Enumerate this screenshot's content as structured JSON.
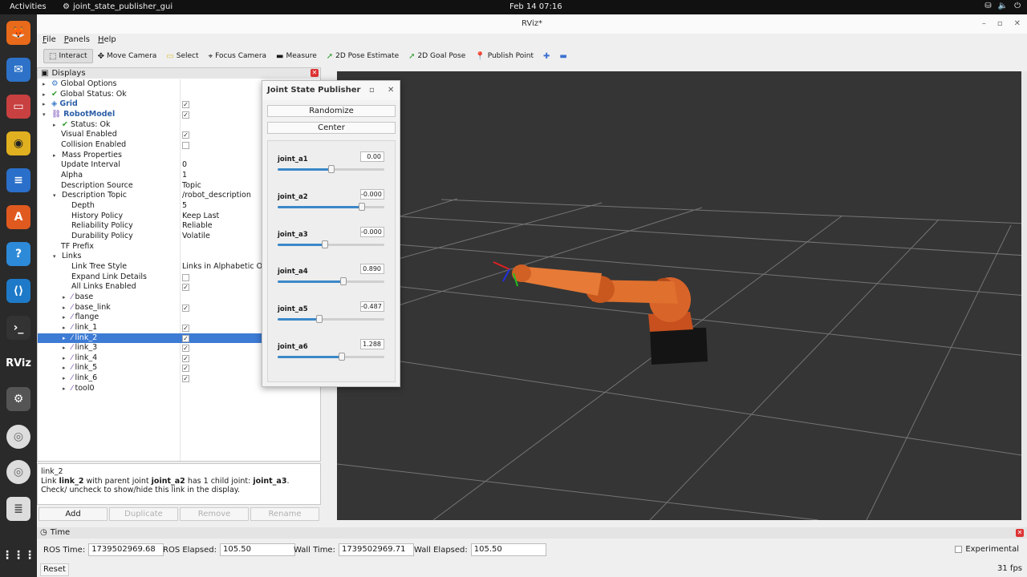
{
  "topbar": {
    "activities": "Activities",
    "app": "joint_state_publisher_gui",
    "clock": "Feb 14  07:16"
  },
  "window": {
    "title": "RViz*"
  },
  "menu": [
    "File",
    "Panels",
    "Help"
  ],
  "toolbar": [
    {
      "label": "Interact",
      "icon": "interact-icon",
      "active": true
    },
    {
      "label": "Move Camera",
      "icon": "move-camera-icon"
    },
    {
      "label": "Select",
      "icon": "select-icon"
    },
    {
      "label": "Focus Camera",
      "icon": "focus-camera-icon"
    },
    {
      "label": "Measure",
      "icon": "measure-icon"
    },
    {
      "label": "2D Pose Estimate",
      "icon": "pose-estimate-icon"
    },
    {
      "label": "2D Goal Pose",
      "icon": "goal-pose-icon"
    },
    {
      "label": "Publish Point",
      "icon": "publish-point-icon"
    }
  ],
  "displays": {
    "title": "Displays",
    "rows": [
      {
        "name": "Global Options",
        "value": "",
        "check": null
      },
      {
        "name": "Global Status: Ok",
        "value": "",
        "check": null
      },
      {
        "name": "Grid",
        "value": "",
        "check": true
      },
      {
        "name": "RobotModel",
        "value": "",
        "check": true
      },
      {
        "name": "Status: Ok",
        "value": "",
        "check": null
      },
      {
        "name": "Visual Enabled",
        "value": "",
        "check": true
      },
      {
        "name": "Collision Enabled",
        "value": "",
        "check": false
      },
      {
        "name": "Mass Properties",
        "value": "",
        "check": null
      },
      {
        "name": "Update Interval",
        "value": "0",
        "check": null
      },
      {
        "name": "Alpha",
        "value": "1",
        "check": null
      },
      {
        "name": "Description Source",
        "value": "Topic",
        "check": null
      },
      {
        "name": "Description Topic",
        "value": "/robot_description",
        "check": null
      },
      {
        "name": "Depth",
        "value": "5",
        "check": null
      },
      {
        "name": "History Policy",
        "value": "Keep Last",
        "check": null
      },
      {
        "name": "Reliability Policy",
        "value": "Reliable",
        "check": null
      },
      {
        "name": "Durability Policy",
        "value": "Volatile",
        "check": null
      },
      {
        "name": "TF Prefix",
        "value": "",
        "check": null
      },
      {
        "name": "Links",
        "value": "",
        "check": null
      },
      {
        "name": "Link Tree Style",
        "value": "Links in Alphabetic Or",
        "check": null
      },
      {
        "name": "Expand Link Details",
        "value": "",
        "check": false
      },
      {
        "name": "All Links Enabled",
        "value": "",
        "check": true
      },
      {
        "name": "base",
        "value": "",
        "check": null
      },
      {
        "name": "base_link",
        "value": "",
        "check": true
      },
      {
        "name": "flange",
        "value": "",
        "check": null
      },
      {
        "name": "link_1",
        "value": "",
        "check": true
      },
      {
        "name": "link_2",
        "value": "",
        "check": true
      },
      {
        "name": "link_3",
        "value": "",
        "check": true
      },
      {
        "name": "link_4",
        "value": "",
        "check": true
      },
      {
        "name": "link_5",
        "value": "",
        "check": true
      },
      {
        "name": "link_6",
        "value": "",
        "check": true
      },
      {
        "name": "tool0",
        "value": "",
        "check": null
      }
    ]
  },
  "help": {
    "title": "link_2",
    "p1": "Link ",
    "b1": "link_2",
    "p2": " with parent joint ",
    "b2": "joint_a2",
    "p3": " has 1 child joint: ",
    "b3": "joint_a3",
    "p4": ". Check/ uncheck to show/hide this link in the display."
  },
  "panel_buttons": [
    "Add",
    "Duplicate",
    "Remove",
    "Rename"
  ],
  "jsp": {
    "title": "Joint State Publisher",
    "randomize": "Randomize",
    "center": "Center",
    "joints": [
      {
        "name": "joint_a1",
        "value": "0.00",
        "fraction": 0.5
      },
      {
        "name": "joint_a2",
        "value": "-0.000",
        "fraction": 0.79
      },
      {
        "name": "joint_a3",
        "value": "-0.000",
        "fraction": 0.44
      },
      {
        "name": "joint_a4",
        "value": "0.890",
        "fraction": 0.62
      },
      {
        "name": "joint_a5",
        "value": "-0.487",
        "fraction": 0.39
      },
      {
        "name": "joint_a6",
        "value": "1.288",
        "fraction": 0.6
      }
    ]
  },
  "time": {
    "title": "Time",
    "ros_time_label": "ROS Time:",
    "ros_time": "1739502969.68",
    "ros_elapsed_label": "ROS Elapsed:",
    "ros_elapsed": "105.50",
    "wall_time_label": "Wall Time:",
    "wall_time": "1739502969.71",
    "wall_elapsed_label": "Wall Elapsed:",
    "wall_elapsed": "105.50",
    "experimental": "Experimental",
    "reset": "Reset",
    "fps": "31 fps"
  },
  "colors": {
    "selection": "#3d7bd4",
    "robot": "#d9642a",
    "viewport": "#353535"
  }
}
